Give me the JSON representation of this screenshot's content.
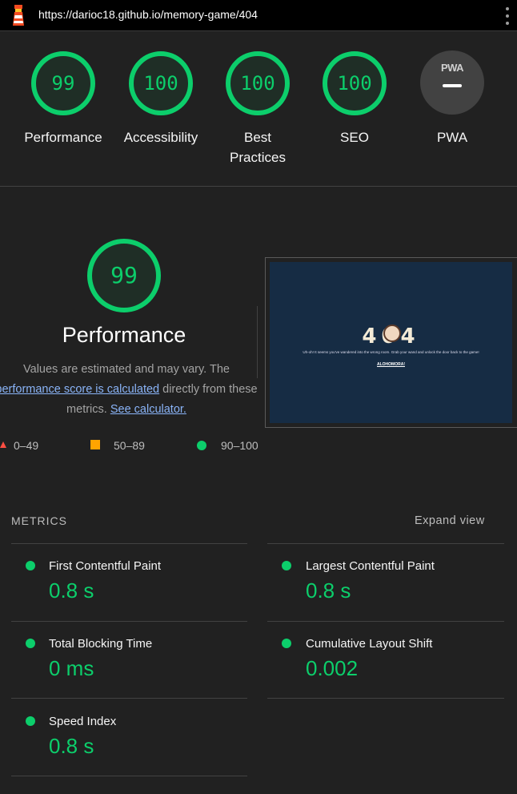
{
  "browser": {
    "url": "https://darioc18.github.io/memory-game/404",
    "logo_icon": "lighthouse-icon",
    "menu_icon": "more-vert-icon"
  },
  "summary": {
    "gauges": [
      {
        "score": "99",
        "label": "Performance"
      },
      {
        "score": "100",
        "label": "Accessibility"
      },
      {
        "score": "100",
        "label": "Best Practices"
      },
      {
        "score": "100",
        "label": "SEO"
      }
    ],
    "pwa": {
      "badge": "PWA",
      "label": "PWA"
    }
  },
  "performance": {
    "score": 99,
    "score_text": "99",
    "title": "Performance",
    "desc_prefix": "Values are estimated and may vary. The ",
    "desc_link": "performance score is calculated",
    "desc_middle": " directly from these metrics. ",
    "calc_link": "See calculator."
  },
  "screenshot_page": {
    "heading": "404",
    "message": "Uh-oh! It seems you've wandered into the wrong room. Grab your wand and unlock the door back to the game!",
    "link": "ALOHOMORA!"
  },
  "legend": {
    "fail": "0–49",
    "average": "50–89",
    "pass": "90–100"
  },
  "metrics": {
    "header": "METRICS",
    "expand": "Expand view",
    "items": [
      {
        "title": "First Contentful Paint",
        "value": "0.8 s"
      },
      {
        "title": "Largest Contentful Paint",
        "value": "0.8 s"
      },
      {
        "title": "Total Blocking Time",
        "value": "0 ms"
      },
      {
        "title": "Cumulative Layout Shift",
        "value": "0.002"
      },
      {
        "title": "Speed Index",
        "value": "0.8 s"
      }
    ]
  },
  "colors": {
    "pass": "#0cce6b",
    "average": "#ffa400",
    "background": "#212121"
  }
}
